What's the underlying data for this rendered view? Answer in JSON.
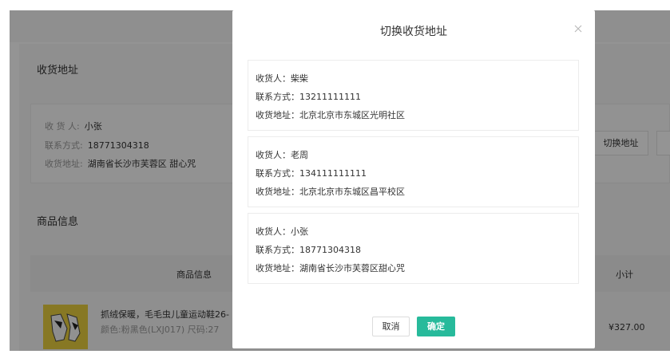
{
  "background": {
    "address_section_title": "收货地址",
    "current_address": {
      "receiver_label": "收 货 人:",
      "receiver_value": "小张",
      "contact_label": "联系方式:",
      "contact_value": "18771304318",
      "address_label": "收货地址:",
      "address_value": "湖南省长沙市芙蓉区 甜心咒"
    },
    "switch_address_button": "切换地址",
    "goods_section_title": "商品信息",
    "goods_table": {
      "columns": [
        "商品信息",
        "小计"
      ]
    },
    "goods_item": {
      "name": "抓绒保暖，毛毛虫儿童运动鞋26-",
      "spec": "颜色:粉黑色(LXJ017) 尺码:27",
      "subtotal": "¥327.00"
    }
  },
  "modal": {
    "title": "切换收货地址",
    "close_icon": "close-icon",
    "addresses": [
      {
        "receiver": "收货人：柴柴",
        "contact": "联系方式：13211111111",
        "address": "收货地址：北京北京市东城区光明社区"
      },
      {
        "receiver": "收货人：老周",
        "contact": "联系方式：134111111111",
        "address": "收货地址：北京北京市东城区昌平校区"
      },
      {
        "receiver": "收货人：小张",
        "contact": "联系方式：18771304318",
        "address": "收货地址：湖南省长沙市芙蓉区甜心咒"
      }
    ],
    "cancel_label": "取消",
    "confirm_label": "确定"
  },
  "colors": {
    "accent": "#27ba9b",
    "overlay": "rgba(0,0,0,0.42)"
  }
}
